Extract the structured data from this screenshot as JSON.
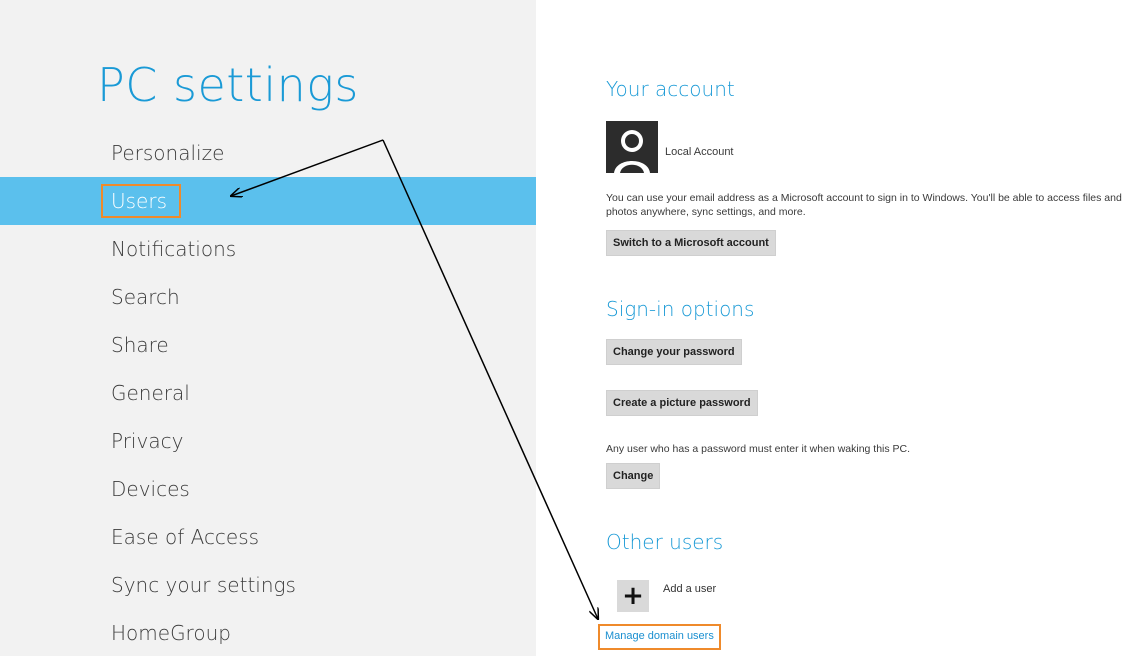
{
  "app": {
    "title": "PC settings"
  },
  "nav": {
    "items": [
      {
        "label": "Personalize"
      },
      {
        "label": "Users",
        "selected": true
      },
      {
        "label": "Notifications"
      },
      {
        "label": "Search"
      },
      {
        "label": "Share"
      },
      {
        "label": "General"
      },
      {
        "label": "Privacy"
      },
      {
        "label": "Devices"
      },
      {
        "label": "Ease of Access"
      },
      {
        "label": "Sync your settings"
      },
      {
        "label": "HomeGroup"
      }
    ]
  },
  "your_account": {
    "title": "Your account",
    "account_type": "Local Account",
    "description": "You can use your email address as a Microsoft account to sign in to Windows. You'll be able to access files and photos anywhere, sync settings, and more.",
    "switch_button": "Switch to a Microsoft account"
  },
  "sign_in_options": {
    "title": "Sign-in options",
    "change_password_button": "Change your password",
    "picture_password_button": "Create a picture password",
    "wake_note": "Any user who has a password must enter it when waking this PC.",
    "change_button": "Change"
  },
  "other_users": {
    "title": "Other users",
    "add_icon": "+",
    "add_user_label": "Add a user",
    "manage_link": "Manage domain users"
  },
  "colors": {
    "accent": "#1a9ad6",
    "selection": "#5bc0ed",
    "highlight_box": "#ef8a2b"
  }
}
